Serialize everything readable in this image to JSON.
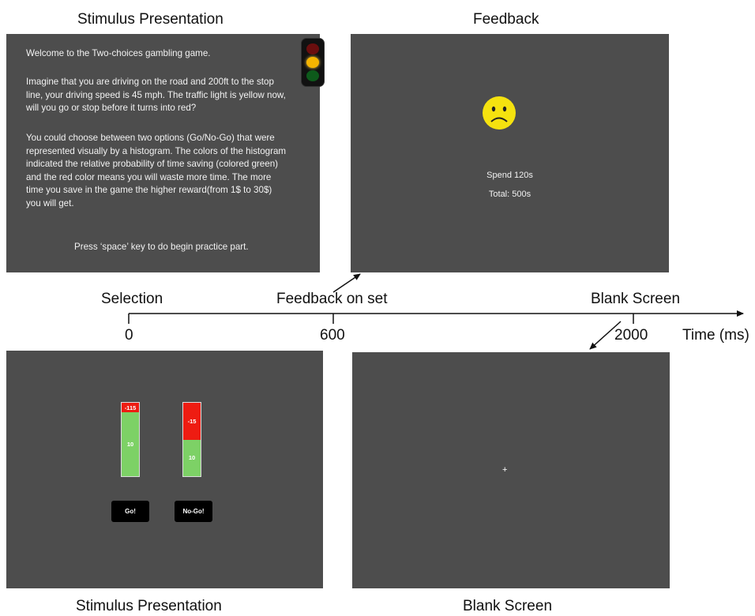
{
  "labels": {
    "top_left": "Stimulus Presentation",
    "top_right": "Feedback",
    "bottom_left": "Stimulus Presentation",
    "bottom_right": "Blank Screen"
  },
  "timeline": {
    "selection": "Selection",
    "feedback_onset": "Feedback on set",
    "blank_screen": "Blank Screen",
    "tick_0": "0",
    "tick_600": "600",
    "tick_2000": "2000",
    "axis_label": "Time (ms)"
  },
  "instructions": {
    "p1": "Welcome to the Two-choices gambling game.",
    "p2_l1": "Imagine that you are driving on the road and  200ft to the stop",
    "p2_l2": "line, your driving speed is 45 mph. The traffic light is yellow now,",
    "p2_l3": "will you go or stop before it turns into red?",
    "p3_l1": "You could choose between two options (Go/No-Go) that were",
    "p3_l2": "represented visually by a histogram. The colors of the histogram",
    "p3_l3": "indicated the relative probability of time saving (colored green)",
    "p3_l4": "and the red color means you will waste more time. The more",
    "p3_l5": "time you save in the game the higher reward(from 1$ to 30$)",
    "p3_l6": "you will get.",
    "prompt": "Press ‘space’ key to do begin practice part."
  },
  "feedback": {
    "spend": "Spend 120s",
    "total": "Total: 500s"
  },
  "histograms": {
    "go": {
      "red_label": "-115",
      "green_label": "10",
      "red_fraction": 0.13
    },
    "nogo": {
      "red_label": "-15",
      "green_label": "10",
      "red_fraction": 0.5
    }
  },
  "buttons": {
    "go": "Go!",
    "nogo": "No-Go!"
  },
  "fixation": "+",
  "colors": {
    "panel": "#4d4d4d",
    "green": "#7dd166",
    "red": "#ee1c12",
    "smiley": "#f5e20f"
  }
}
